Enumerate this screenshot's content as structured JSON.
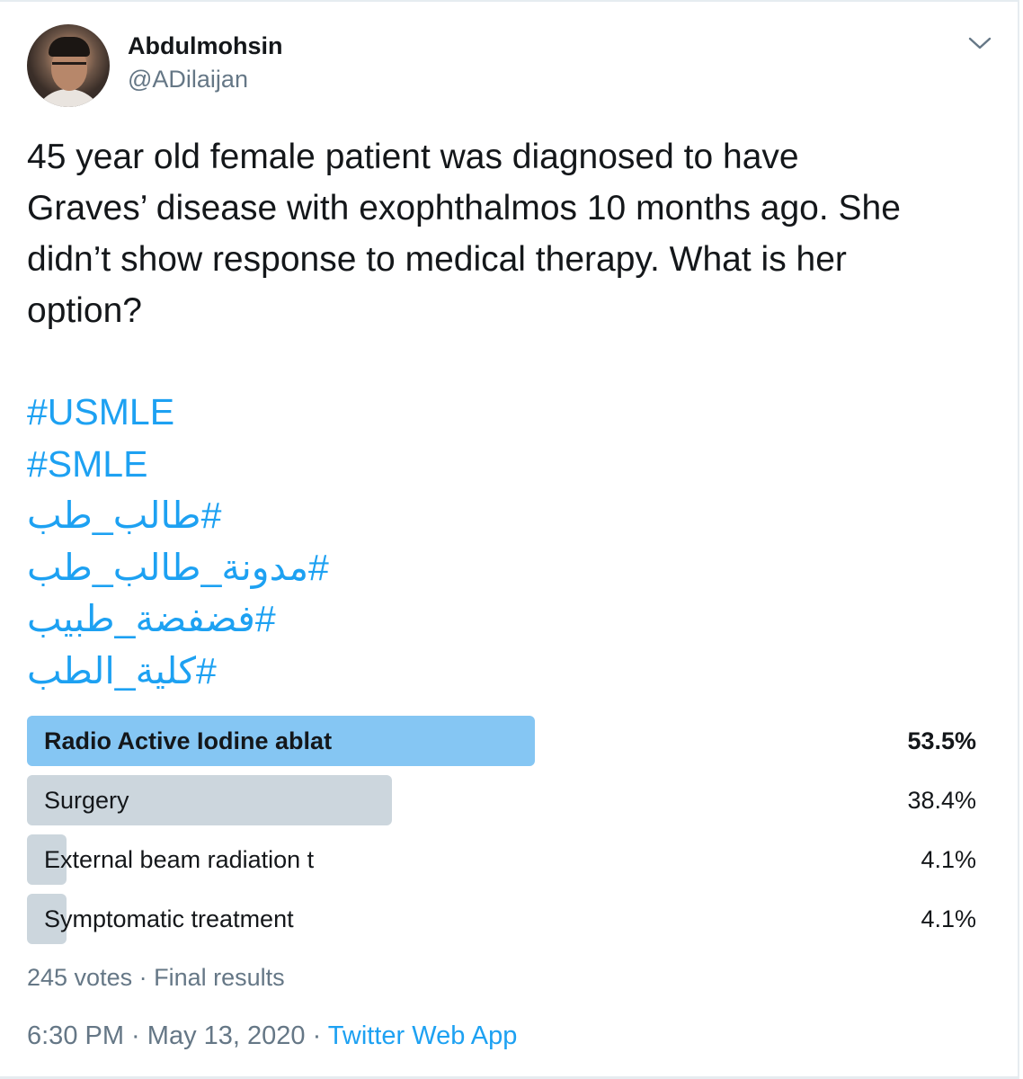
{
  "user": {
    "display_name": "Abdulmohsin",
    "handle": "@ADilaijan"
  },
  "tweet": {
    "text": "45 year old female patient was diagnosed to have\nGraves’ disease with exophthalmos 10 months ago. She\ndidn’t show response to medical therapy. What is her\noption?",
    "hashtags": [
      "#USMLE",
      "#SMLE",
      "#طالب_طب",
      "#مدونة_طالب_طب",
      "#فضفضة_طبيب",
      "#كلية_الطب"
    ]
  },
  "poll": {
    "options": [
      {
        "label": "Radio Active Iodine ablat",
        "percent_text": "53.5%",
        "percent": 53.5,
        "winner": true
      },
      {
        "label": "Surgery",
        "percent_text": "38.4%",
        "percent": 38.4,
        "winner": false
      },
      {
        "label": "External beam radiation t",
        "percent_text": "4.1%",
        "percent": 4.1,
        "winner": false
      },
      {
        "label": "Symptomatic treatment",
        "percent_text": "4.1%",
        "percent": 4.1,
        "winner": false
      }
    ],
    "votes": "245 votes",
    "separator": " · ",
    "status": "Final results"
  },
  "footer": {
    "time": "6:30 PM",
    "date": "May 13, 2020",
    "separator": " · ",
    "source": "Twitter Web App"
  },
  "colors": {
    "link": "#1da1f2",
    "winner_bar": "#85c6f3",
    "other_bar": "#ccd6dd",
    "secondary_text": "#657786"
  },
  "icons": {
    "avatar": "avatar-photo",
    "more": "chevron-down-icon"
  }
}
